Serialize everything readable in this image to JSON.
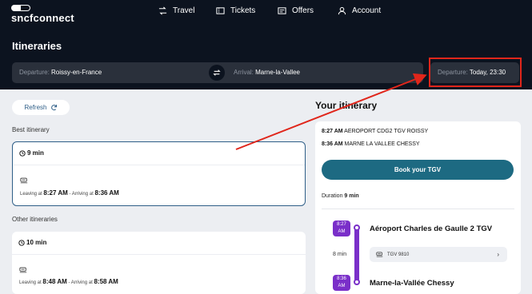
{
  "brand": {
    "logo_text": "sncfconnect"
  },
  "nav": {
    "travel": "Travel",
    "tickets": "Tickets",
    "offers": "Offers",
    "account": "Account"
  },
  "page_title": "Itineraries",
  "search": {
    "departure_label": "Departure:",
    "departure_value": "Roissy-en-France",
    "arrival_label": "Arrival:",
    "arrival_value": "Marne-la-Vallee",
    "time_label": "Departure:",
    "time_value": "Today, 23:30"
  },
  "results": {
    "refresh_label": "Refresh",
    "best_label": "Best itinerary",
    "other_label": "Other itineraries",
    "best": {
      "duration": "9 min",
      "leaving_label": "Leaving at",
      "leaving_time": "8:27 AM",
      "arriving_label": "- Arriving at",
      "arriving_time": "8:36 AM"
    },
    "other": {
      "duration": "10 min",
      "leaving_label": "Leaving at",
      "leaving_time": "8:48 AM",
      "arriving_label": "- Arriving at",
      "arriving_time": "8:58 AM"
    }
  },
  "itinerary": {
    "title": "Your itinerary",
    "line1_time": "8:27 AM",
    "line1_text": "AEROPORT CDG2 TGV ROISSY",
    "line2_time": "8:36 AM",
    "line2_text": "MARNE LA VALLEE CHESSY",
    "book_label": "Book your TGV",
    "duration_label": "Duration",
    "duration_value": "9 min",
    "dep_badge_time": "8:27",
    "dep_badge_ampm": "AM",
    "arr_badge_time": "8:36",
    "arr_badge_ampm": "AM",
    "from_station": "Aéroport Charles de Gaulle 2 TGV",
    "to_station": "Marne-la-Vallée Chessy",
    "segment_duration": "8 min",
    "train_label": "TGV 9810"
  },
  "colors": {
    "header_bg": "#0c131f",
    "field_bg": "#2a303b",
    "book_button": "#1d6a82",
    "timeline": "#7a2fc9",
    "annotation": "#e0261b"
  },
  "icons": [
    "travel-icon",
    "ticket-icon",
    "offers-icon",
    "account-icon",
    "swap-icon",
    "refresh-icon",
    "clock-icon",
    "train-icon",
    "chevron-right-icon"
  ]
}
